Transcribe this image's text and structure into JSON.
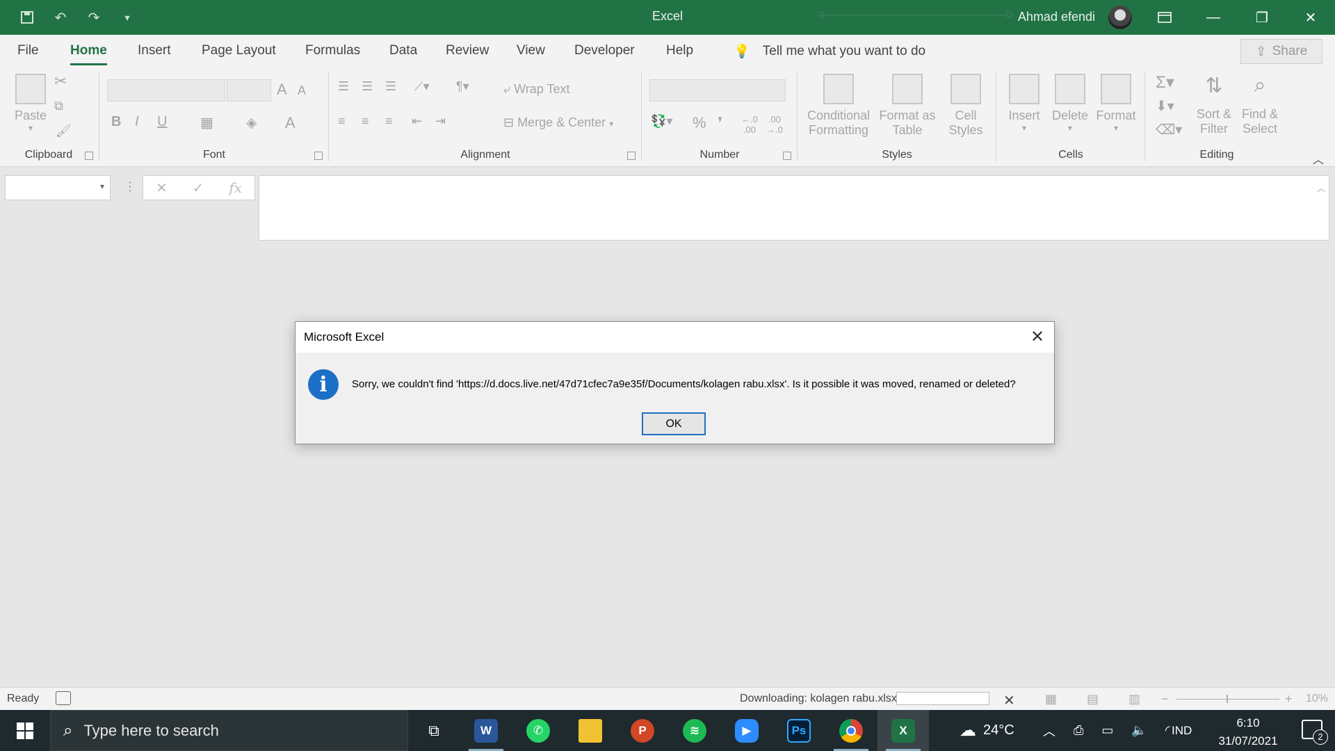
{
  "window": {
    "title": "Excel",
    "user_name": "Ahmad efendi"
  },
  "tabs": [
    "File",
    "Home",
    "Insert",
    "Page Layout",
    "Formulas",
    "Data",
    "Review",
    "View",
    "Developer",
    "Help"
  ],
  "active_tab": "Home",
  "tell_me": "Tell me what you want to do",
  "share_label": "Share",
  "ribbon": {
    "clipboard": {
      "label": "Clipboard",
      "paste": "Paste"
    },
    "font": {
      "label": "Font"
    },
    "alignment": {
      "label": "Alignment",
      "wrap_text": "Wrap Text",
      "merge_center": "Merge & Center"
    },
    "number": {
      "label": "Number"
    },
    "styles": {
      "label": "Styles",
      "conditional_1": "Conditional",
      "conditional_2": "Formatting",
      "format_table_1": "Format as",
      "format_table_2": "Table",
      "cell_styles_1": "Cell",
      "cell_styles_2": "Styles"
    },
    "cells": {
      "label": "Cells",
      "insert": "Insert",
      "delete": "Delete",
      "format": "Format"
    },
    "editing": {
      "label": "Editing",
      "sort_1": "Sort &",
      "sort_2": "Filter",
      "find_1": "Find &",
      "find_2": "Select"
    }
  },
  "dialog": {
    "title": "Microsoft Excel",
    "message": "Sorry, we couldn't find 'https://d.docs.live.net/47d71cfec7a9e35f/Documents/kolagen rabu.xlsx'. Is it possible it was moved, renamed or deleted?",
    "ok_label": "OK"
  },
  "status": {
    "ready": "Ready",
    "downloading": "Downloading: kolagen rabu.xlsx",
    "download_progress": 0.0,
    "zoom": "10%"
  },
  "taskbar": {
    "search_placeholder": "Type here to search",
    "temperature": "24°C",
    "language": "IND",
    "time": "6:10",
    "date": "31/07/2021",
    "notification_count": "2"
  },
  "colors": {
    "excel_green": "#217346",
    "dialog_accent": "#1f6fc4",
    "taskbar": "#1f2a2e"
  }
}
